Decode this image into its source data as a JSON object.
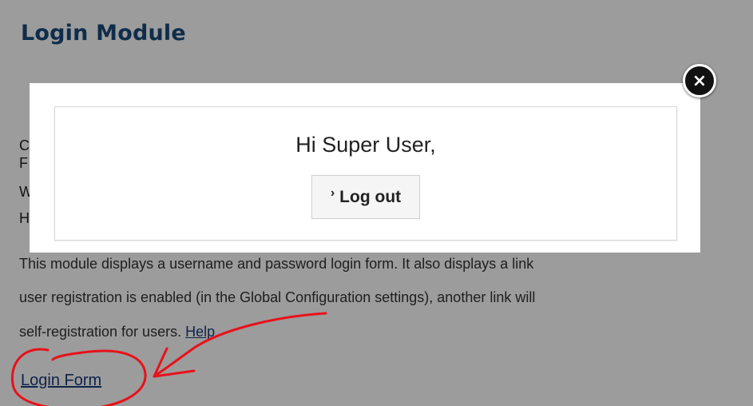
{
  "page": {
    "title": "Login Module",
    "side_letters": [
      "C",
      "F",
      "W",
      "H"
    ],
    "description": {
      "line1": "This module displays a username and password login form. It also displays a link",
      "line2": "user registration is enabled (in the Global Configuration settings), another link will",
      "line3_text": "self-registration for users.",
      "help_link": "Help"
    },
    "login_form_link": "Login Form"
  },
  "modal": {
    "greeting": "Hi Super User,",
    "logout_chevron": "›",
    "logout_label": "Log out",
    "close_symbol": "×"
  },
  "colors": {
    "overlay": "#000000",
    "title": "#1a4a7a",
    "link": "#1a3c78",
    "annotation": "#e8111b"
  }
}
